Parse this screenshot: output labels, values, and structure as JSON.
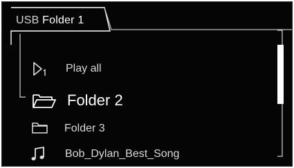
{
  "tab": {
    "path_label": "USB",
    "current_label": "Folder 1"
  },
  "items": [
    {
      "icon": "play-all-icon",
      "label": "Play all",
      "selected": false
    },
    {
      "icon": "folder-open-icon",
      "label": "Folder 2",
      "selected": true
    },
    {
      "icon": "folder-icon",
      "label": "Folder 3",
      "selected": false
    },
    {
      "icon": "music-note-icon",
      "label": "Bob_Dylan_Best_Song",
      "selected": false
    }
  ],
  "colors": {
    "background": "#050505",
    "text": "#d9d9d9",
    "selected_text": "#ffffff",
    "frame_line": "#cfcfcf"
  }
}
